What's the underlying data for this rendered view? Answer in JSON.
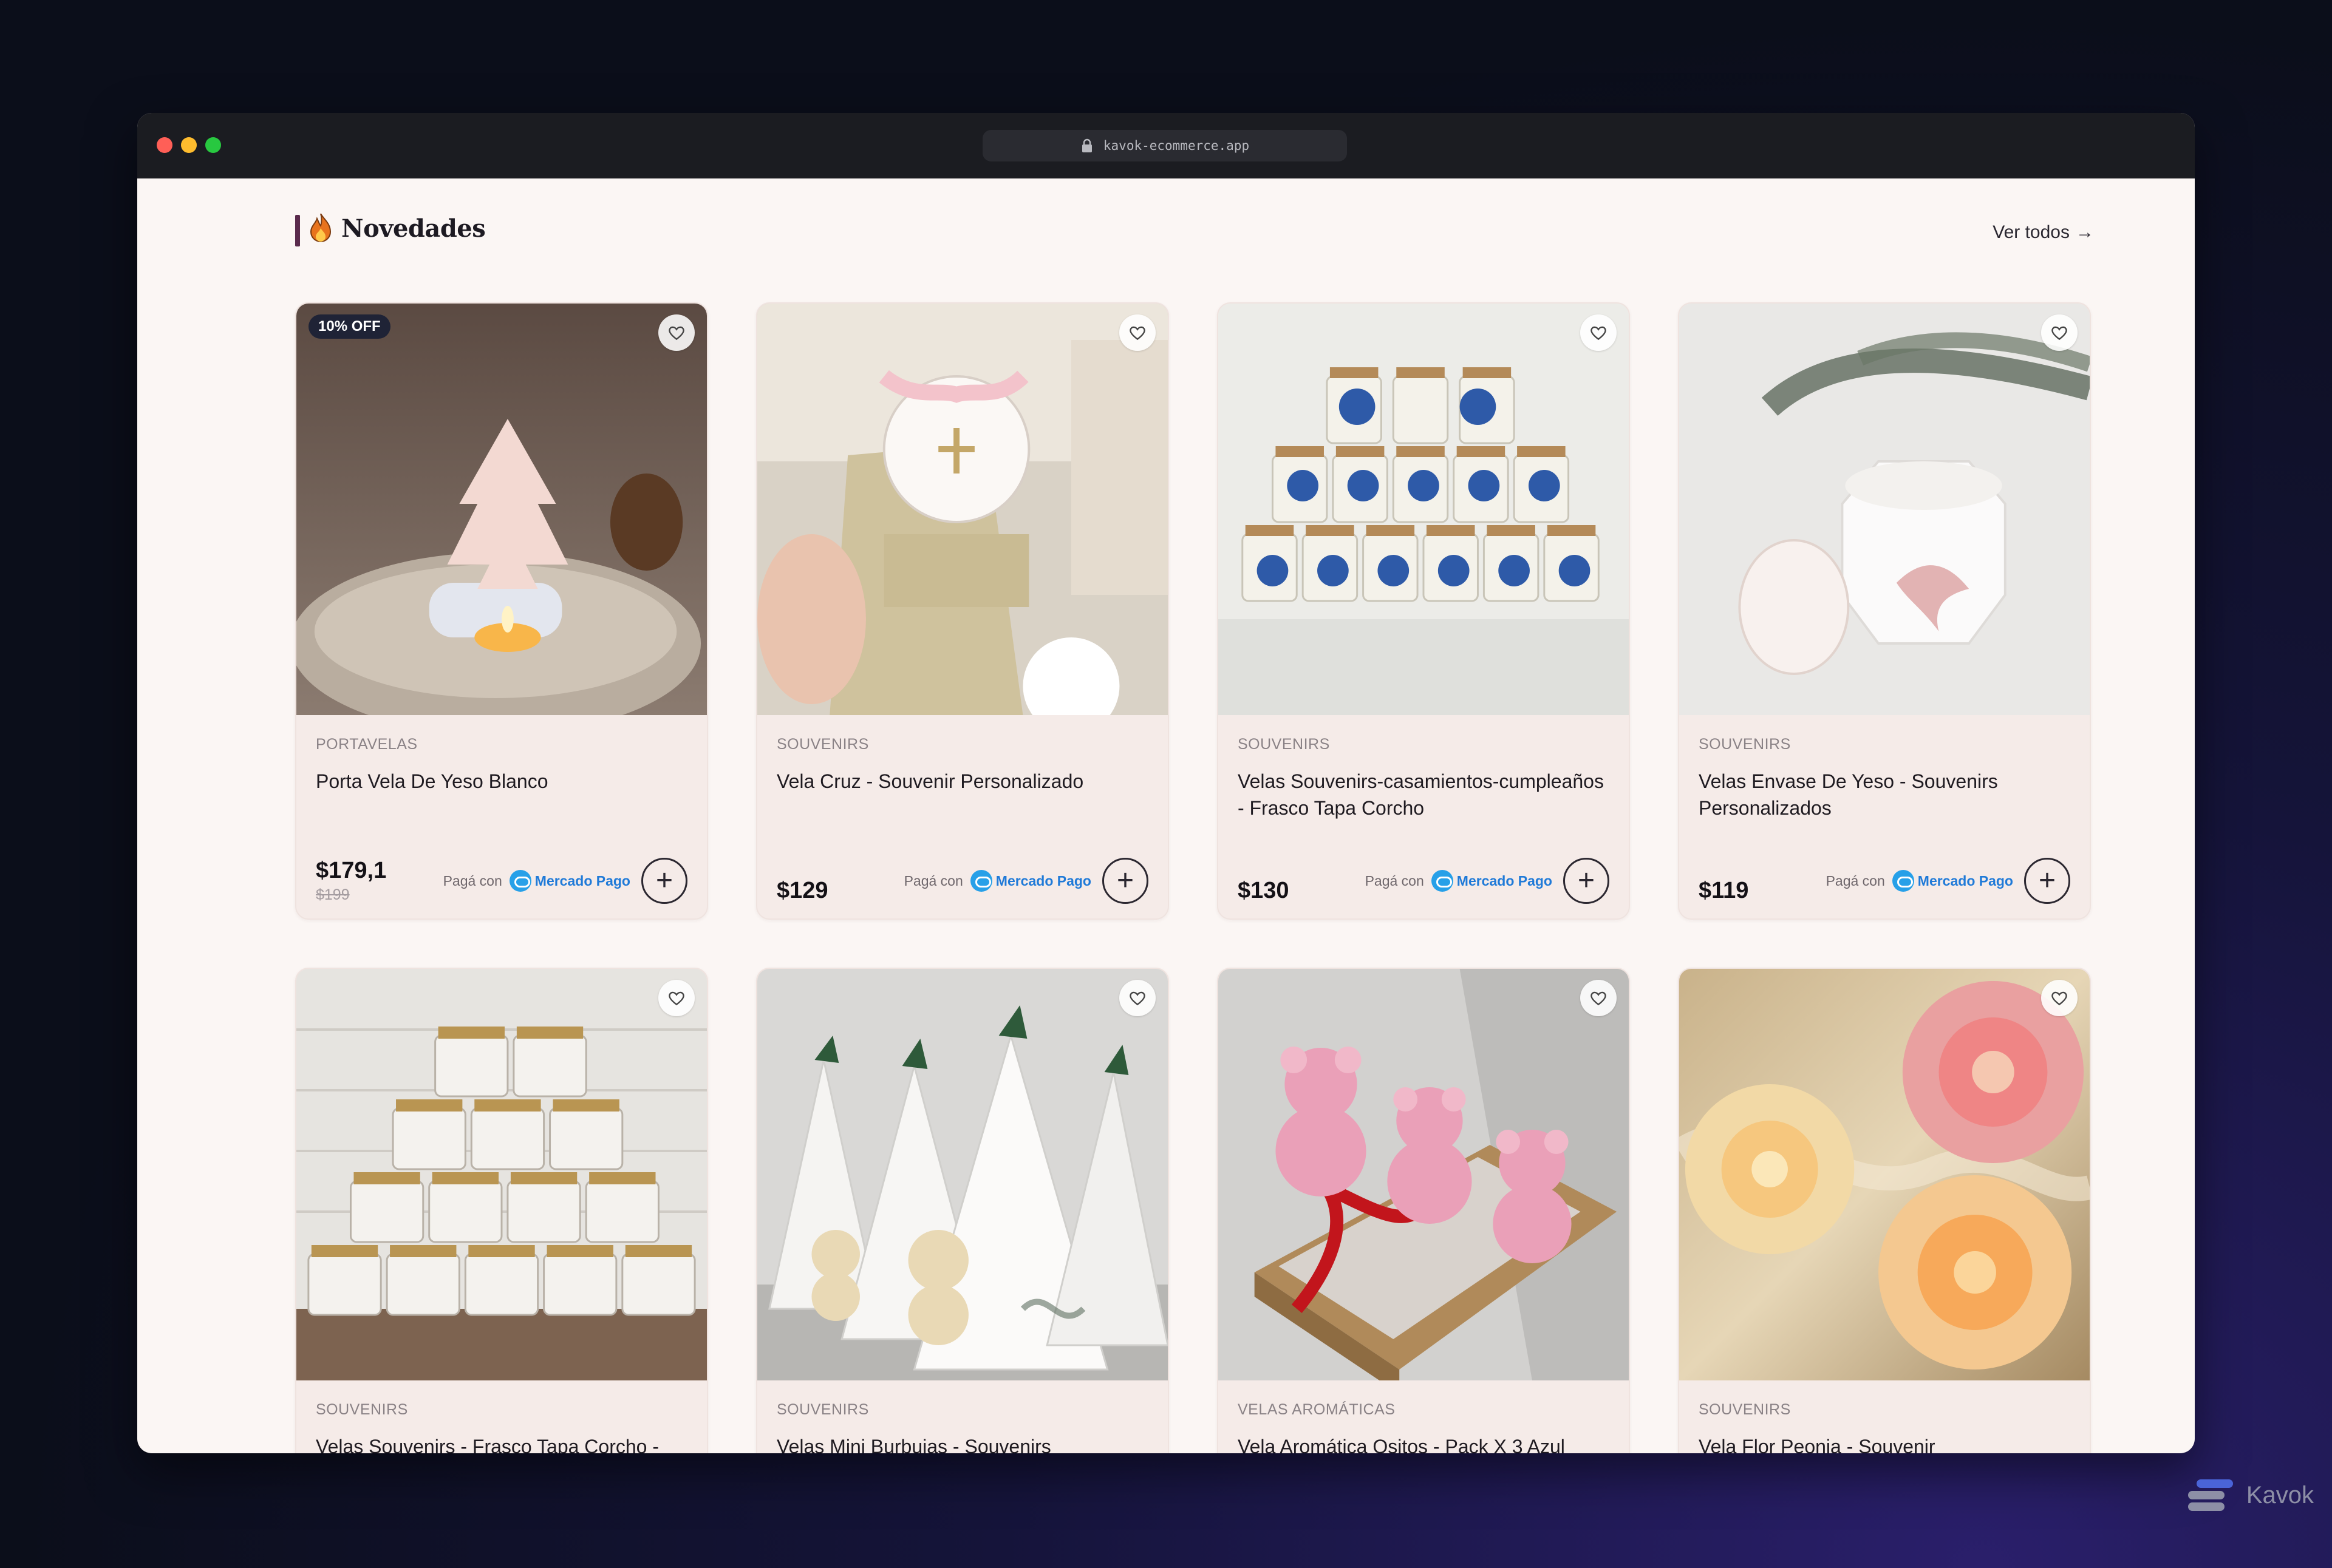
{
  "browser": {
    "url": "kavok-ecommerce.app"
  },
  "section": {
    "title": "Novedades",
    "see_all": "Ver todos",
    "see_all_arrow": "→"
  },
  "products": [
    {
      "category": "PORTAVELAS",
      "name": "Porta Vela De Yeso Blanco",
      "price": "$179,1",
      "old_price": "$199",
      "badge": "10% OFF",
      "pay_label": "Pagá con",
      "pay_brand": "Mercado Pago"
    },
    {
      "category": "SOUVENIRS",
      "name": "Vela Cruz - Souvenir Personalizado",
      "price": "$129",
      "pay_label": "Pagá con",
      "pay_brand": "Mercado Pago"
    },
    {
      "category": "SOUVENIRS",
      "name": "Velas Souvenirs-casamientos-cumpleaños - Frasco Tapa Corcho",
      "price": "$130",
      "pay_label": "Pagá con",
      "pay_brand": "Mercado Pago"
    },
    {
      "category": "SOUVENIRS",
      "name": "Velas Envase De Yeso - Souvenirs Personalizados",
      "price": "$119",
      "pay_label": "Pagá con",
      "pay_brand": "Mercado Pago"
    },
    {
      "category": "SOUVENIRS",
      "name": "Velas Souvenirs - Frasco Tapa Corcho -"
    },
    {
      "category": "SOUVENIRS",
      "name": "Velas Mini Burbujas - Souvenirs"
    },
    {
      "category": "VELAS AROMÁTICAS",
      "name": "Vela Aromática Ositos - Pack X 3 Azul"
    },
    {
      "category": "SOUVENIRS",
      "name": "Vela Flor Peonia - Souvenir"
    }
  ],
  "watermark": {
    "text": "Kavok"
  },
  "colors": {
    "accent": "#5a2a4c",
    "mercado_pago": "#1f7ad8",
    "badge_bg": "#1f2336"
  }
}
